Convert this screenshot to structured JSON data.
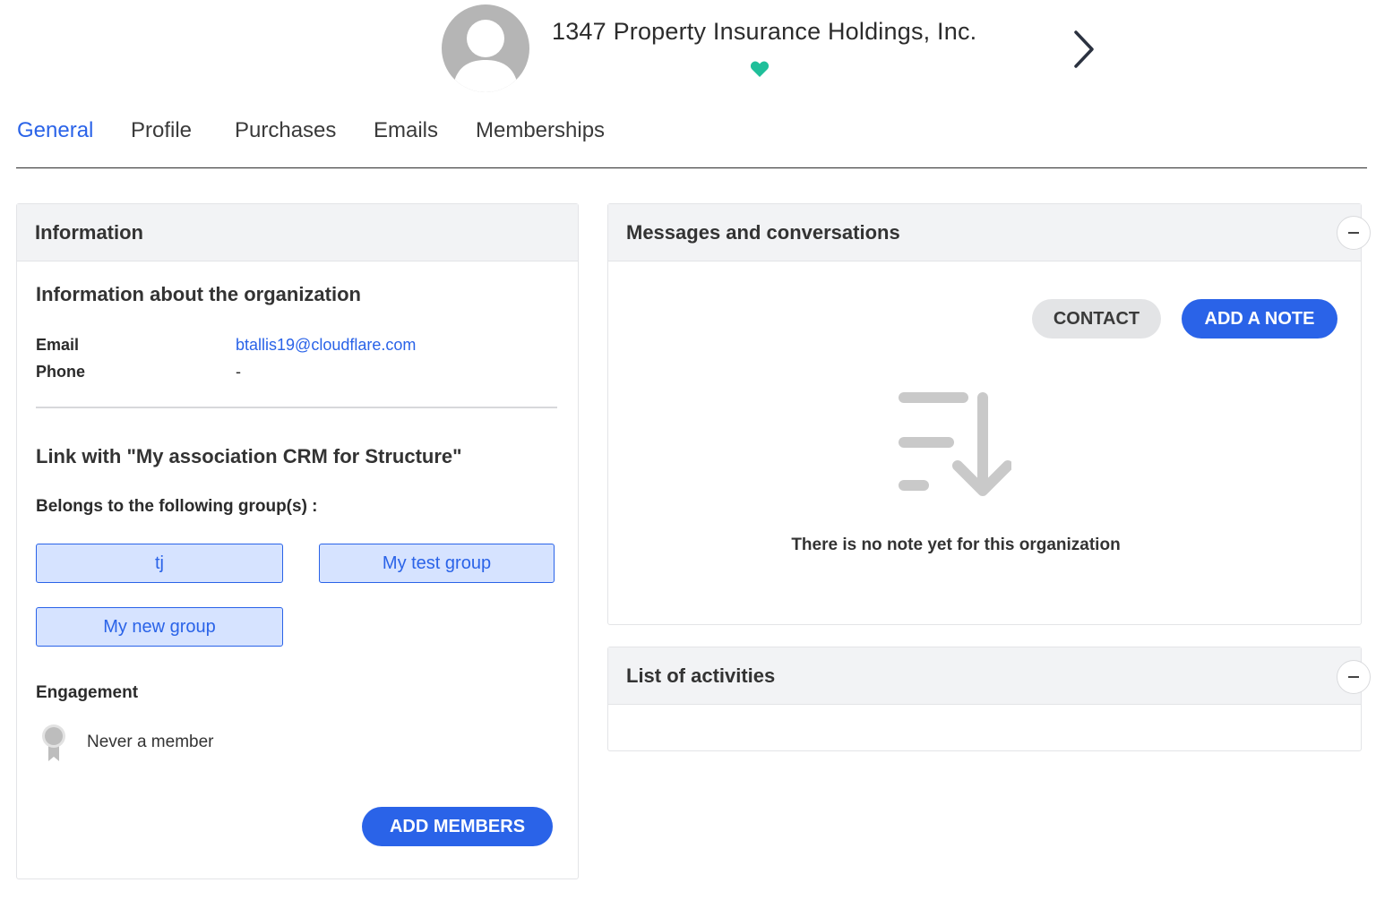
{
  "header": {
    "org_name": "1347 Property Insurance Holdings, Inc.",
    "heart_color": "#1fbf9a"
  },
  "tabs": [
    {
      "label": "General",
      "active": true
    },
    {
      "label": "Profile",
      "active": false
    },
    {
      "label": "Purchases",
      "active": false
    },
    {
      "label": "Emails",
      "active": false
    },
    {
      "label": "Memberships",
      "active": false
    }
  ],
  "information": {
    "panel_title": "Information",
    "about_title": "Information about the organization",
    "email_label": "Email",
    "email_value": "btallis19@cloudflare.com",
    "phone_label": "Phone",
    "phone_value": "-",
    "link_title": "Link with \"My association CRM for Structure\"",
    "groups_label": "Belongs to the following group(s) :",
    "groups": [
      "tj",
      "My test group",
      "My new group"
    ],
    "engagement_label": "Engagement",
    "engagement_value": "Never a member",
    "add_members_label": "ADD MEMBERS"
  },
  "messages": {
    "panel_title": "Messages and conversations",
    "contact_label": "CONTACT",
    "add_note_label": "ADD A NOTE",
    "empty_text": "There is no note yet for this organization"
  },
  "activities": {
    "panel_title": "List of activities"
  },
  "colors": {
    "accent": "#2a63e8",
    "chip_bg": "#d6e3ff",
    "panel_header_bg": "#f2f3f5"
  }
}
